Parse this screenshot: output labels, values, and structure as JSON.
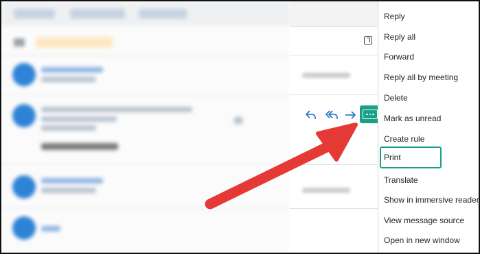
{
  "menu": {
    "items": [
      {
        "label": "Reply"
      },
      {
        "label": "Reply all"
      },
      {
        "label": "Forward"
      },
      {
        "label": "Reply all by meeting"
      },
      {
        "label": "Delete"
      },
      {
        "label": "Mark as unread"
      },
      {
        "label": "Create rule"
      },
      {
        "label": "Print"
      },
      {
        "label": "Translate"
      },
      {
        "label": "Show in immersive reader"
      },
      {
        "label": "View message source"
      },
      {
        "label": "Open in new window"
      }
    ],
    "highlighted": "Print"
  },
  "colors": {
    "accent_teal": "#17a187",
    "arrow_red": "#e53935",
    "action_blue": "#1f6fc5",
    "avatar_blue": "#2f83d6"
  },
  "icons": {
    "reply": "reply-icon",
    "reply_all": "reply-all-icon",
    "forward": "forward-icon",
    "more": "more-actions-icon",
    "popout": "open-in-new-window-icon"
  }
}
